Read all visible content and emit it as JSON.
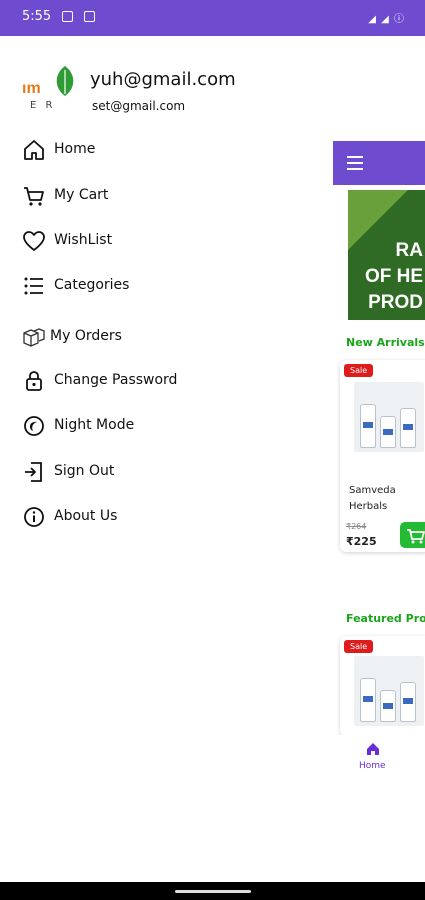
{
  "status_bar": {
    "time": "5:55"
  },
  "drawer": {
    "logo": {
      "brand_text": "ım",
      "sub_text": "E R"
    },
    "user": {
      "email_primary": "yuh@gmail.com",
      "email_secondary": "set@gmail.com"
    },
    "items": [
      {
        "label": "Home",
        "icon": "home-icon"
      },
      {
        "label": "My Cart",
        "icon": "cart-icon"
      },
      {
        "label": "WishList",
        "icon": "heart-icon"
      },
      {
        "label": "Categories",
        "icon": "list-icon"
      },
      {
        "label": "My Orders",
        "icon": "boxes-icon"
      },
      {
        "label": "Change Password",
        "icon": "lock-icon"
      },
      {
        "label": "Night Mode",
        "icon": "moon-icon"
      },
      {
        "label": "Sign Out",
        "icon": "sign-out-icon"
      },
      {
        "label": "About Us",
        "icon": "info-icon"
      }
    ]
  },
  "background": {
    "banner_lines": [
      "RA",
      "OF HE",
      "PROD"
    ],
    "new_arrivals_title": "New Arrivals",
    "featured_title": "Featured Prod",
    "sale_badge": "Sale",
    "product": {
      "name_line1": "Samveda",
      "name_line2": "Herbals",
      "old_price": "₹264",
      "price": "₹225"
    },
    "bottom_nav_home": "Home"
  },
  "colors": {
    "primary": "#6f4ccf",
    "green": "#1aa51a",
    "sale_red": "#e01b1b"
  }
}
